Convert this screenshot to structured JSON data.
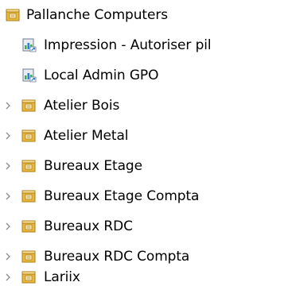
{
  "tree": {
    "root": {
      "label": "Pallanche Computers",
      "icon": "ou-folder-icon",
      "expanded": true
    },
    "gpo_links": [
      {
        "label": "Impression - Autoriser pil",
        "icon": "gpo-link-icon"
      },
      {
        "label": "Local Admin GPO",
        "icon": "gpo-link-icon"
      }
    ],
    "ous": [
      {
        "label": "Atelier Bois",
        "icon": "ou-folder-icon",
        "expander": "chevron-right-icon"
      },
      {
        "label": "Atelier Metal",
        "icon": "ou-folder-icon",
        "expander": "chevron-right-icon"
      },
      {
        "label": "Bureaux Etage",
        "icon": "ou-folder-icon",
        "expander": "chevron-right-icon"
      },
      {
        "label": "Bureaux Etage Compta",
        "icon": "ou-folder-icon",
        "expander": "chevron-right-icon"
      },
      {
        "label": "Bureaux RDC",
        "icon": "ou-folder-icon",
        "expander": "chevron-right-icon"
      },
      {
        "label": "Bureaux RDC Compta",
        "icon": "ou-folder-icon",
        "expander": "chevron-right-icon"
      },
      {
        "label": "Lariix",
        "icon": "ou-folder-icon",
        "expander": "chevron-right-icon"
      }
    ],
    "colors": {
      "folder_body": "#e6b93f",
      "folder_edge": "#b07d14",
      "folder_light": "#f9e29a",
      "gpo_doc": "#e9edf3",
      "gpo_doc_edge": "#6b7a90",
      "gpo_bars": "#3fae49",
      "gpo_bars_alt": "#2b7fd6",
      "chevron": "#8a8a8a"
    }
  }
}
